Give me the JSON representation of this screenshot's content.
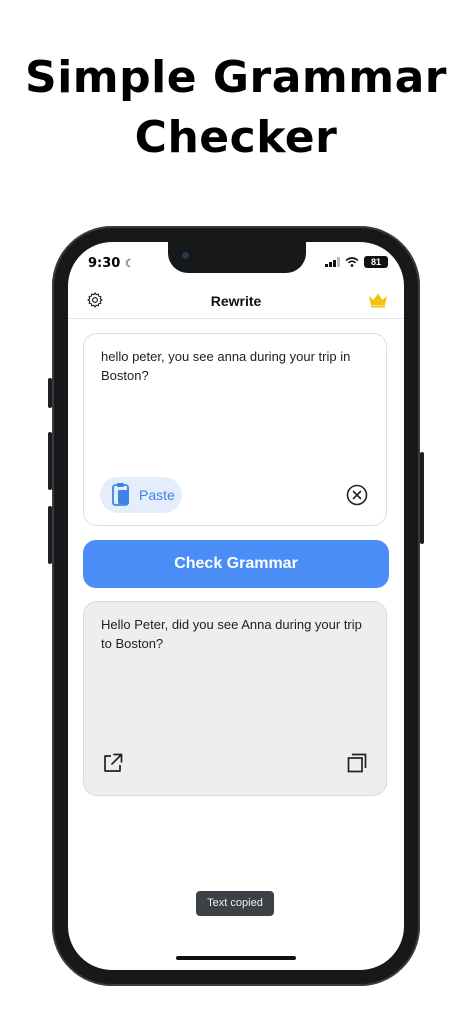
{
  "headline": {
    "line1": "Simple Grammar",
    "line2": "Checker"
  },
  "status_bar": {
    "time": "9:30",
    "battery": "81"
  },
  "navbar": {
    "title": "Rewrite"
  },
  "input": {
    "text": "hello peter, you see anna during your trip in Boston?",
    "paste_label": "Paste"
  },
  "check_button": {
    "label": "Check Grammar"
  },
  "output": {
    "text": "Hello Peter, did you see Anna during your trip to Boston?"
  },
  "toast": {
    "text": "Text copied"
  },
  "icons": {
    "settings": "gear-icon",
    "premium": "crown-icon",
    "paste": "clipboard-icon",
    "clear": "close-circle-icon",
    "share": "share-external-icon",
    "copy": "copy-icon"
  },
  "colors": {
    "accent": "#4a8df6",
    "paste_bg": "#e4eefb",
    "paste_text": "#3f82e6",
    "crown": "#f4c20d",
    "output_bg": "#eeeeee",
    "toast_bg": "#3e4048"
  }
}
